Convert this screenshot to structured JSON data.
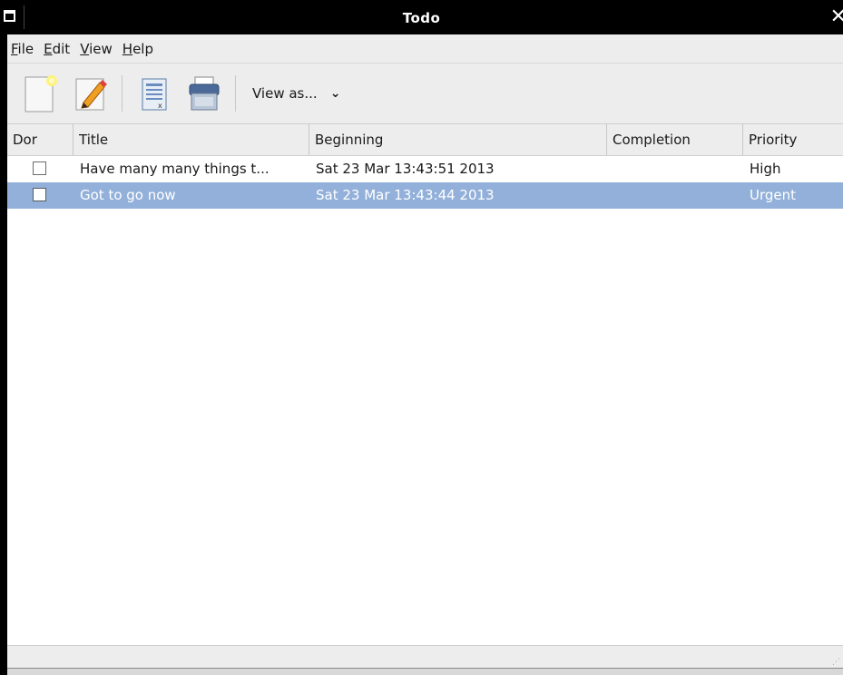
{
  "window": {
    "title": "Todo"
  },
  "menubar": {
    "items": [
      {
        "label": "File"
      },
      {
        "label": "Edit"
      },
      {
        "label": "View"
      },
      {
        "label": "Help"
      }
    ]
  },
  "toolbar": {
    "view_as_label": "View as..."
  },
  "table": {
    "columns": [
      "Dor",
      "Title",
      "Beginning",
      "Completion",
      "Priority"
    ],
    "rows": [
      {
        "done": false,
        "title": "Have many many things t...",
        "beginning": "Sat 23 Mar 13:43:51 2013",
        "completion": "",
        "priority": "High",
        "selected": false
      },
      {
        "done": false,
        "title": "Got to go now",
        "beginning": "Sat 23 Mar 13:43:44 2013",
        "completion": "",
        "priority": "Urgent",
        "selected": true
      }
    ]
  },
  "colors": {
    "selection": "#92b0da",
    "chrome": "#ededed"
  }
}
